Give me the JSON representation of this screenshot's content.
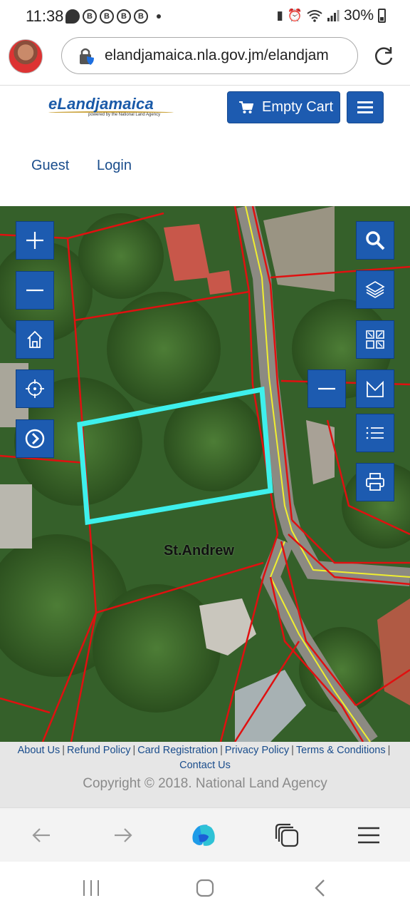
{
  "status_bar": {
    "time": "11:38",
    "battery": "30%",
    "notifications": [
      "chat-icon",
      "b-icon",
      "b-icon",
      "b-icon",
      "b-icon"
    ],
    "icons": [
      "sim-icon",
      "alarm-icon",
      "wifi-icon",
      "signal-icon",
      "battery-icon"
    ]
  },
  "browser": {
    "url": "elandjamaica.nla.gov.jm/elandjam"
  },
  "site": {
    "logo_text": "eLandjamaica",
    "logo_subtext": "powered by the National Land Agency",
    "cart_label": "Empty Cart",
    "nav_guest": "Guest",
    "nav_login": "Login"
  },
  "map": {
    "label": "St.Andrew",
    "left_controls": [
      "zoom-in-icon",
      "zoom-out-icon",
      "home-icon",
      "locate-icon",
      "next-icon"
    ],
    "right_controls": [
      "search-icon",
      "layers-icon",
      "qr-icon",
      "measure-icon",
      "list-icon",
      "print-icon"
    ],
    "colors": {
      "button": "#1d5bb0",
      "parcel_lines": "#e01010",
      "road_line": "#f0ee30",
      "selected_parcel": "#3ef0ec"
    }
  },
  "footer": {
    "links": [
      "About Us",
      "Refund Policy",
      "Card Registration",
      "Privacy Policy",
      "Terms & Conditions",
      "Contact Us"
    ],
    "copyright": "Copyright © 2018. National Land Agency"
  },
  "bottom_bar": {
    "icons": [
      "back-icon",
      "forward-icon",
      "copilot-icon",
      "tabs-icon",
      "menu-icon"
    ]
  },
  "system_nav": {
    "icons": [
      "recents-icon",
      "home-nav-icon",
      "back-nav-icon"
    ]
  }
}
